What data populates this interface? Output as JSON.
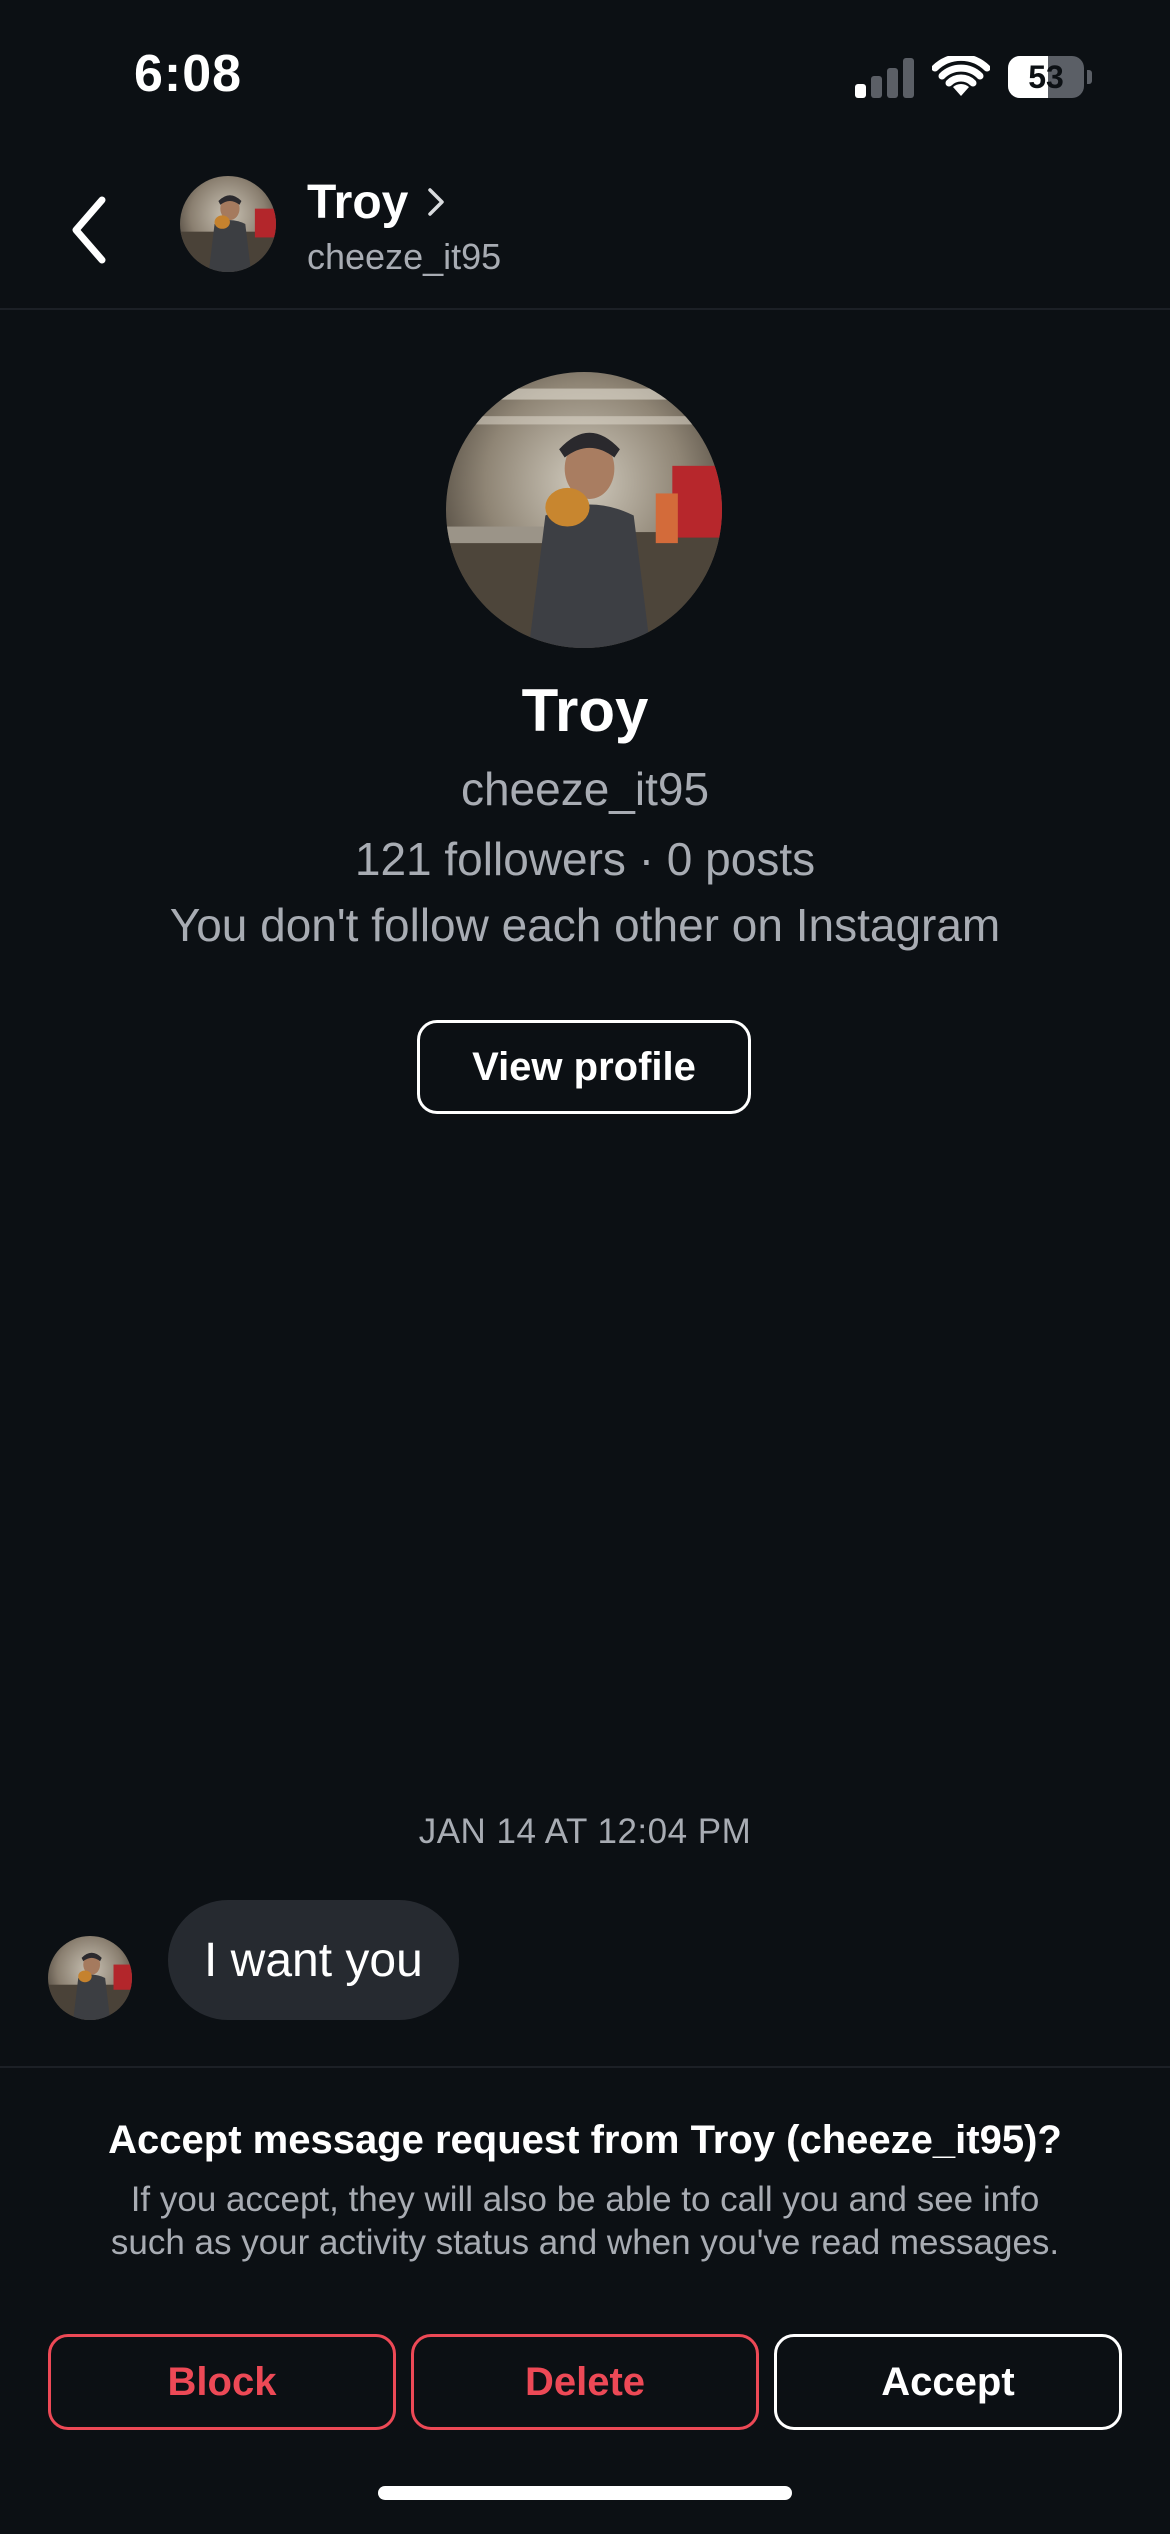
{
  "status_bar": {
    "time": "6:08",
    "battery_percent": "53",
    "battery_level": 0.53,
    "signal_bars_active": 1,
    "signal_bars_total": 4
  },
  "header": {
    "back_icon": "chevron-left-icon",
    "name": "Troy",
    "chevron_icon": "chevron-right-icon",
    "username": "cheeze_it95"
  },
  "profile": {
    "name": "Troy",
    "username": "cheeze_it95",
    "stats": "121 followers · 0 posts",
    "follow_note": "You don't follow each other on Instagram",
    "view_profile_label": "View profile"
  },
  "conversation": {
    "timestamp": "JAN 14 AT 12:04 PM",
    "messages": [
      {
        "sender": "Troy",
        "text": "I want you"
      }
    ]
  },
  "request": {
    "title": "Accept message request from Troy (cheeze_it95)?",
    "body_line1": "If you accept, they will also be able to call you and see info",
    "body_line2": "such as your activity status and when you've read messages.",
    "block_label": "Block",
    "delete_label": "Delete",
    "accept_label": "Accept"
  },
  "colors": {
    "background": "#0c1014",
    "danger": "#ed4956",
    "muted_text": "#a8acb3",
    "bubble": "#262a30"
  }
}
